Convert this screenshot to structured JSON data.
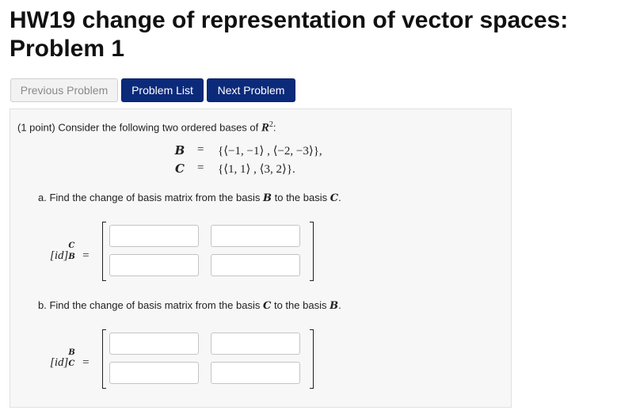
{
  "page": {
    "title": "HW19 change of representation of vector spaces: Problem 1"
  },
  "nav": {
    "previous": "Previous Problem",
    "list": "Problem List",
    "next": "Next Problem"
  },
  "problem": {
    "points": "(1 point)",
    "intro": "Consider the following two ordered bases of",
    "space": "R",
    "space_exp": "2",
    "colon": ":",
    "basis_b_name": "B",
    "basis_b": "{⟨−1, −1⟩ , ⟨−2, −3⟩},",
    "basis_c_name": "C",
    "basis_c": "{⟨1, 1⟩ , ⟨3, 2⟩}.",
    "equals": "=",
    "part_a": {
      "prefix": "a. Find the change of basis matrix from the basis",
      "from": "B",
      "middle": "to the basis",
      "to": "C",
      "end": ".",
      "lhs": "[id]",
      "lhs_sup": "C",
      "lhs_sub": "B",
      "cells": [
        "",
        "",
        "",
        ""
      ]
    },
    "part_b": {
      "prefix": "b. Find the change of basis matrix from the basis",
      "from": "C",
      "middle": "to the basis",
      "to": "B",
      "end": ".",
      "lhs": "[id]",
      "lhs_sup": "B",
      "lhs_sub": "C",
      "cells": [
        "",
        "",
        "",
        ""
      ]
    }
  }
}
